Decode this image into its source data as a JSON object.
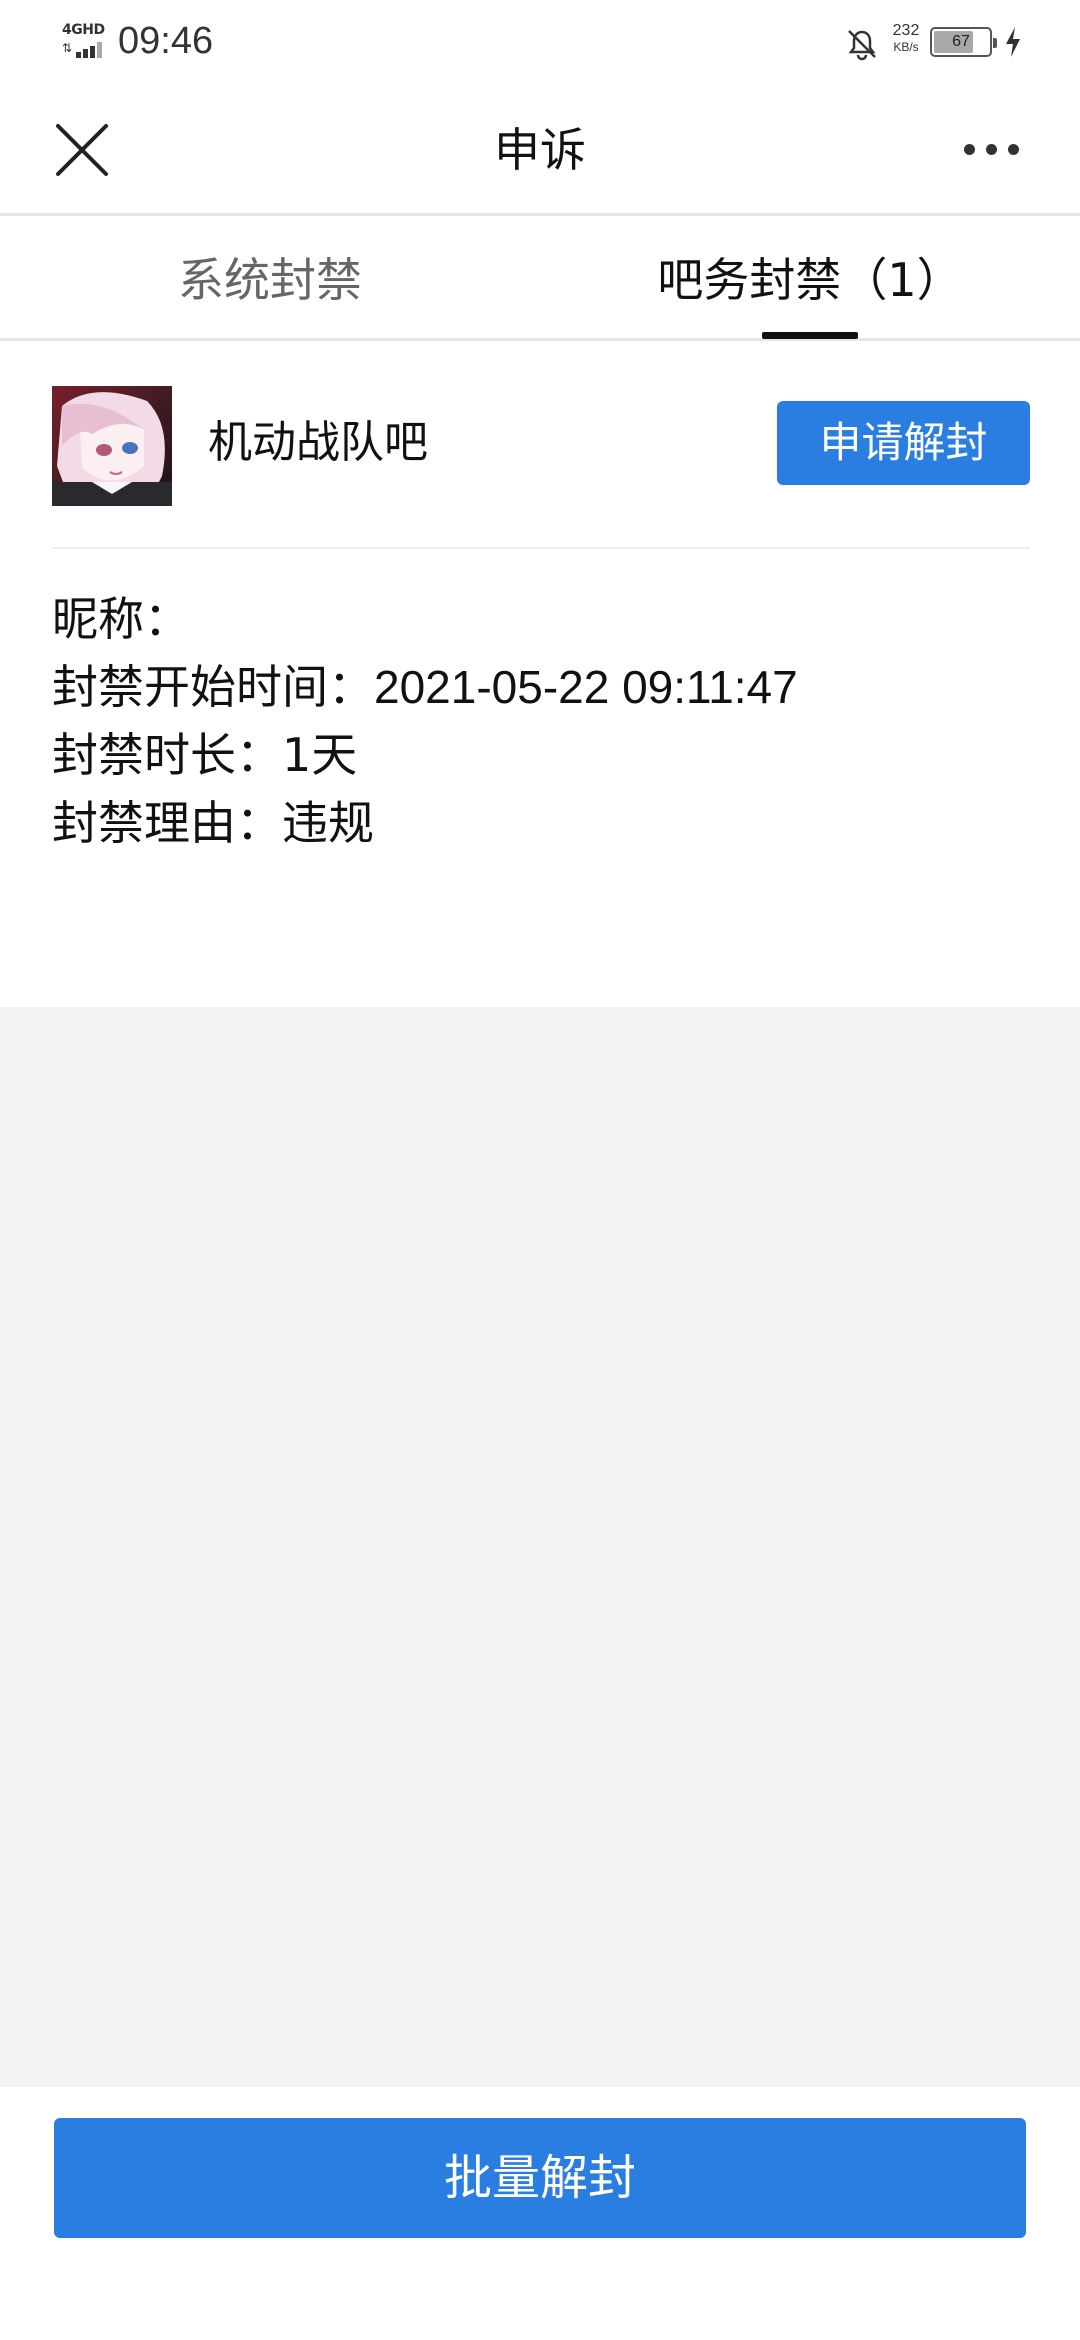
{
  "status_bar": {
    "network": "4GHD",
    "time": "09:46",
    "net_speed": "232",
    "net_speed_unit": "KB/s",
    "battery_level": "67",
    "icons": [
      "signal-icon",
      "bell-muted-icon",
      "battery-icon",
      "charging-icon"
    ]
  },
  "nav": {
    "title": "申诉",
    "close_icon": "close-icon",
    "more_icon": "more-dots-icon"
  },
  "tabs": [
    {
      "label": "系统封禁",
      "active": false
    },
    {
      "label": "吧务封禁（1）",
      "active": true
    }
  ],
  "ban": {
    "forum_name": "机动战队吧",
    "unban_button": "申请解封",
    "nickname_label": "昵称：",
    "nickname_value": "",
    "start_label": "封禁开始时间：",
    "start_value": "2021-05-22 09:11:47",
    "duration_label": "封禁时长：",
    "duration_value": "1天",
    "reason_label": "封禁理由：",
    "reason_value": "违规"
  },
  "footer": {
    "batch_button": "批量解封"
  },
  "colors": {
    "accent": "#2a7de1",
    "background_empty": "#f3f3f3",
    "tab_inactive": "#666666"
  }
}
